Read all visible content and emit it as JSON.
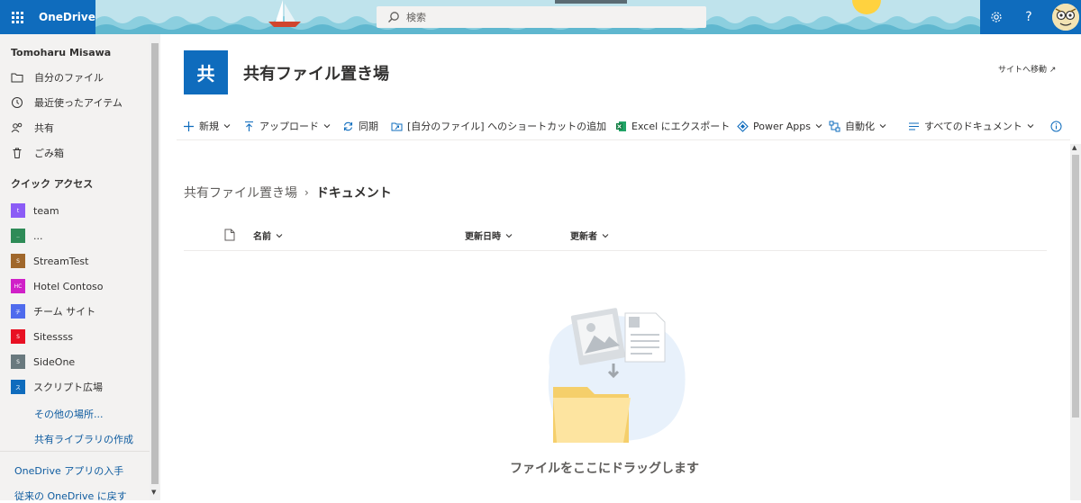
{
  "header": {
    "app_name": "OneDrive",
    "search_placeholder": "検索",
    "settings_label": "⚙",
    "help_label": "?"
  },
  "nav": {
    "user_name": "Tomoharu Misawa",
    "items": [
      {
        "label": "自分のファイル",
        "icon": "folder-icon"
      },
      {
        "label": "最近使ったアイテム",
        "icon": "recent-icon"
      },
      {
        "label": "共有",
        "icon": "people-icon"
      },
      {
        "label": "ごみ箱",
        "icon": "recycle-bin-icon"
      }
    ],
    "quick_access_title": "クイック アクセス",
    "sites": [
      {
        "label": "team",
        "badge": "t",
        "color": "#8b5cf6"
      },
      {
        "label": "...",
        "badge": "..",
        "color": "#2e8b57"
      },
      {
        "label": "StreamTest",
        "badge": "S",
        "color": "#a0672b"
      },
      {
        "label": "Hotel Contoso",
        "badge": "HC",
        "color": "#d020c8"
      },
      {
        "label": "チーム サイト",
        "badge": "チ",
        "color": "#4f6bed"
      },
      {
        "label": "Sitessss",
        "badge": "S",
        "color": "#e81123"
      },
      {
        "label": "SideOne",
        "badge": "S",
        "color": "#69797e"
      },
      {
        "label": "スクリプト広場",
        "badge": "ス",
        "color": "#0f6cbd"
      }
    ],
    "more_places": "その他の場所...",
    "create_library": "共有ライブラリの作成",
    "get_app": "OneDrive アプリの入手",
    "back_classic": "従来の OneDrive に戻す"
  },
  "site": {
    "logo_char": "共",
    "title": "共有ファイル置き場",
    "go_to_site": "サイトへ移動 ↗"
  },
  "commands": {
    "new": "新規",
    "upload": "アップロード",
    "sync": "同期",
    "add_shortcut": "[自分のファイル] へのショートカットの追加",
    "export_excel": "Excel にエクスポート",
    "power_apps": "Power Apps",
    "automate": "自動化",
    "view": "すべてのドキュメント"
  },
  "breadcrumb": {
    "parent": "共有ファイル置き場",
    "separator": "›",
    "current": "ドキュメント"
  },
  "columns": {
    "name": "名前",
    "modified": "更新日時",
    "modified_by": "更新者"
  },
  "empty_state": {
    "message": "ファイルをここにドラッグします"
  }
}
